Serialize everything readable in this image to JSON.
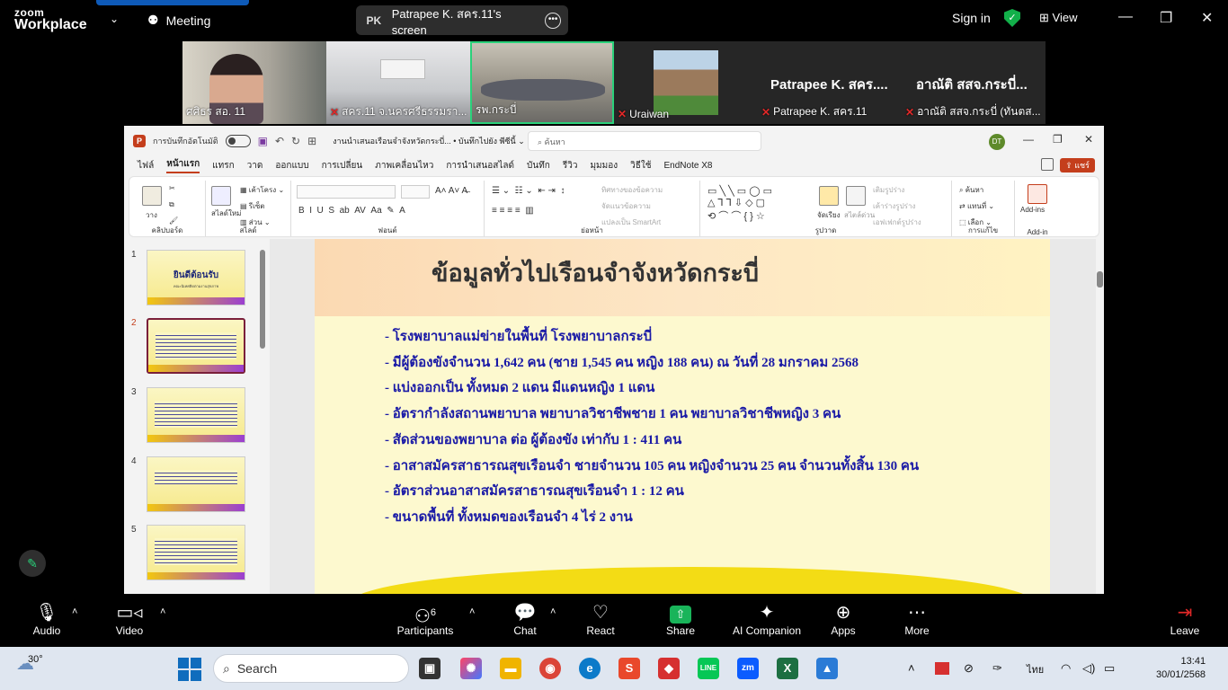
{
  "zoom": {
    "brand_top": "zoom",
    "brand_bottom": "Workplace",
    "meeting_label": "Meeting",
    "share_initials": "PK",
    "share_label": "Patrapee K. สคร.11's screen",
    "sign_in": "Sign in",
    "view": "View",
    "participants": [
      {
        "name": "ศศิธร สอ. 11",
        "muted": false
      },
      {
        "name": "สคร.11 จ.นครศรีธรรมรา...",
        "muted": true
      },
      {
        "name": "รพ.กระบี่",
        "muted": false
      },
      {
        "name": "Uraiwan",
        "muted": true
      },
      {
        "name": "Patrapee K. สคร.11",
        "muted": true,
        "big": "Patrapee K. สคร...."
      },
      {
        "name": "อาณัติ สสจ.กระบี่ (ทันตส...",
        "muted": true,
        "big": "อาณัติ สสจ.กระบี่..."
      }
    ],
    "toolbar": {
      "audio": "Audio",
      "video": "Video",
      "participants": "Participants",
      "participants_count": "6",
      "chat": "Chat",
      "react": "React",
      "share": "Share",
      "ai": "AI Companion",
      "apps": "Apps",
      "more": "More",
      "leave": "Leave"
    }
  },
  "ppt": {
    "autosave": "การบันทึกอัตโนมัติ",
    "docname": "งานนำเสนอเรือนจำจังหวัดกระบี่... • บันทึกไปยัง พีซีนี้ ⌄",
    "search_placeholder": "ค้นหา",
    "avatar": "DT",
    "tabs": [
      "ไฟล์",
      "หน้าแรก",
      "แทรก",
      "วาด",
      "ออกแบบ",
      "การเปลี่ยน",
      "ภาพเคลื่อนไหว",
      "การนำเสนอสไลด์",
      "บันทึก",
      "รีวิว",
      "มุมมอง",
      "วิธีใช้",
      "EndNote X8"
    ],
    "share_btn": "แชร์",
    "ribbon": {
      "clipboard": "คลิปบอร์ด",
      "paste": "วาง",
      "slides": "สไลด์",
      "new_slide": "สไลด์ใหม่",
      "layout": "เค้าโครง",
      "reset": "รีเซ็ต",
      "section": "ส่วน",
      "font": "ฟอนต์",
      "paragraph": "ย่อหน้า",
      "text_direction": "ทิศทางของข้อความ",
      "align_text": "จัดแนวข้อความ",
      "smartart": "แปลงเป็น SmartArt",
      "drawing": "รูปวาด",
      "arrange": "จัดเรียง",
      "quick_styles": "สไตล์ด่วน",
      "shape_fill": "เติมรูปร่าง",
      "shape_outline": "เค้าร่างรูปร่าง",
      "shape_effects": "เอฟเฟกต์รูปร่าง",
      "find": "ค้นหา",
      "replace": "แทนที่",
      "select": "เลือก",
      "editing": "การแก้ไข",
      "addins": "Add-ins",
      "addins_cap": "Add-in"
    },
    "thumbs": [
      {
        "n": "1",
        "title": "ยินดีต้อนรับ",
        "sub": "คณะนิเทศติดตามงานสุขภาพ"
      },
      {
        "n": "2",
        "title": "",
        "sub": ""
      },
      {
        "n": "3",
        "title": "",
        "sub": ""
      },
      {
        "n": "4",
        "title": "",
        "sub": ""
      },
      {
        "n": "5",
        "title": "",
        "sub": ""
      }
    ],
    "slide": {
      "title": "ข้อมูลทั่วไปเรือนจำจังหวัดกระบี่",
      "bullets": [
        "- โรงพยาบาลแม่ข่ายในพื้นที่  โรงพยาบาลกระบี่",
        "-  มีผู้ต้องขังจำนวน 1,642 คน (ชาย 1,545 คน หญิง 188 คน) ณ วันที่ 28 มกราคม 2568",
        "-  แบ่งออกเป็น ทั้งหมด 2 แดน  มีแดนหญิง 1 แดน",
        "-  อัตรากำลังสถานพยาบาล พยาบาลวิชาชีพชาย 1 คน พยาบาลวิชาชีพหญิง 3 คน",
        "-  สัดส่วนของพยาบาล ต่อ ผู้ต้องขัง เท่ากับ 1 : 411 คน",
        "-  อาสาสมัครสาธารณสุขเรือนจำ ชายจำนวน   105   คน หญิงจำนวน 25 คน จำนวนทั้งสิ้น 130 คน",
        "-  อัตราส่วนอาสาสมัครสาธารณสุขเรือนจำ 1 : 12 คน",
        "- ขนาดพื้นที่ ทั้งหมดของเรือนจำ 4 ไร่ 2 งาน"
      ]
    }
  },
  "taskbar": {
    "temp": "30°",
    "search": "Search",
    "lang": "ไทย",
    "time": "13:41",
    "date": "30/01/2568"
  }
}
